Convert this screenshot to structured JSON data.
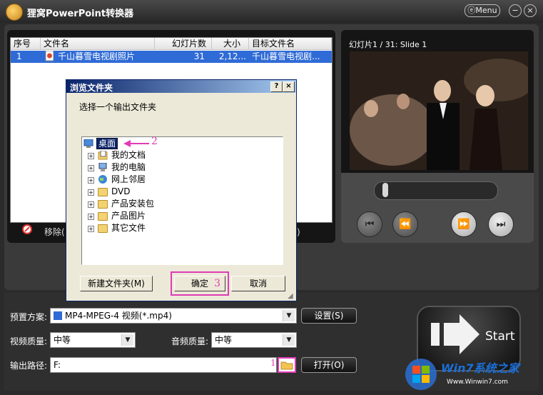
{
  "app": {
    "title": "狸窝PowerPoint转换器",
    "menu_label": "Menu",
    "minimize": "−",
    "close": "×"
  },
  "file_list": {
    "columns": [
      "序号",
      "文件名",
      "幻灯片数",
      "大小",
      "目标文件名"
    ],
    "rows": [
      {
        "index": "1",
        "filename": "千山暮雪电视剧照片",
        "slides": "31",
        "size": "2,12...",
        "target": "千山暮雪电视剧..."
      }
    ]
  },
  "list_actions": {
    "remove_label": "移除(",
    "move_label": "动)"
  },
  "preview": {
    "counter": "幻灯片1 / 31: Slide 1",
    "prev_icon": "prev-icon",
    "rewind_icon": "rewind-icon",
    "forward_icon": "fast-forward-icon",
    "next_icon": "next-icon"
  },
  "settings": {
    "preset_label": "预置方案:",
    "preset_value": "MP4-MPEG-4 视频(*.mp4)",
    "settings_button": "设置(S)",
    "video_quality_label": "视频质量:",
    "video_quality_value": "中等",
    "audio_quality_label": "音频质量:",
    "audio_quality_value": "中等",
    "output_label": "输出路径:",
    "output_value": "F:",
    "output_marker": "1",
    "open_button": "打开(O)",
    "start_label": "Start"
  },
  "dialog": {
    "title": "浏览文件夹",
    "help_btn": "?",
    "close_btn": "×",
    "prompt": "选择一个输出文件夹",
    "tree": [
      {
        "label": "桌面",
        "selected": true
      },
      {
        "label": "我的文档"
      },
      {
        "label": "我的电脑"
      },
      {
        "label": "网上邻居"
      },
      {
        "label": "DVD"
      },
      {
        "label": "产品安装包"
      },
      {
        "label": "产品图片"
      },
      {
        "label": "其它文件"
      }
    ],
    "desktop_marker": "2",
    "new_folder_button": "新建文件夹(M)",
    "ok_button": "确定",
    "ok_marker": "3",
    "cancel_button": "取消"
  },
  "watermark": {
    "brand": "Win7系统之家",
    "url": "Www.Winwin7.com"
  },
  "colors": {
    "highlight": "#2f6bd6",
    "annotation_pink": "#e23bb5",
    "dialog_title": "#0a246a"
  }
}
